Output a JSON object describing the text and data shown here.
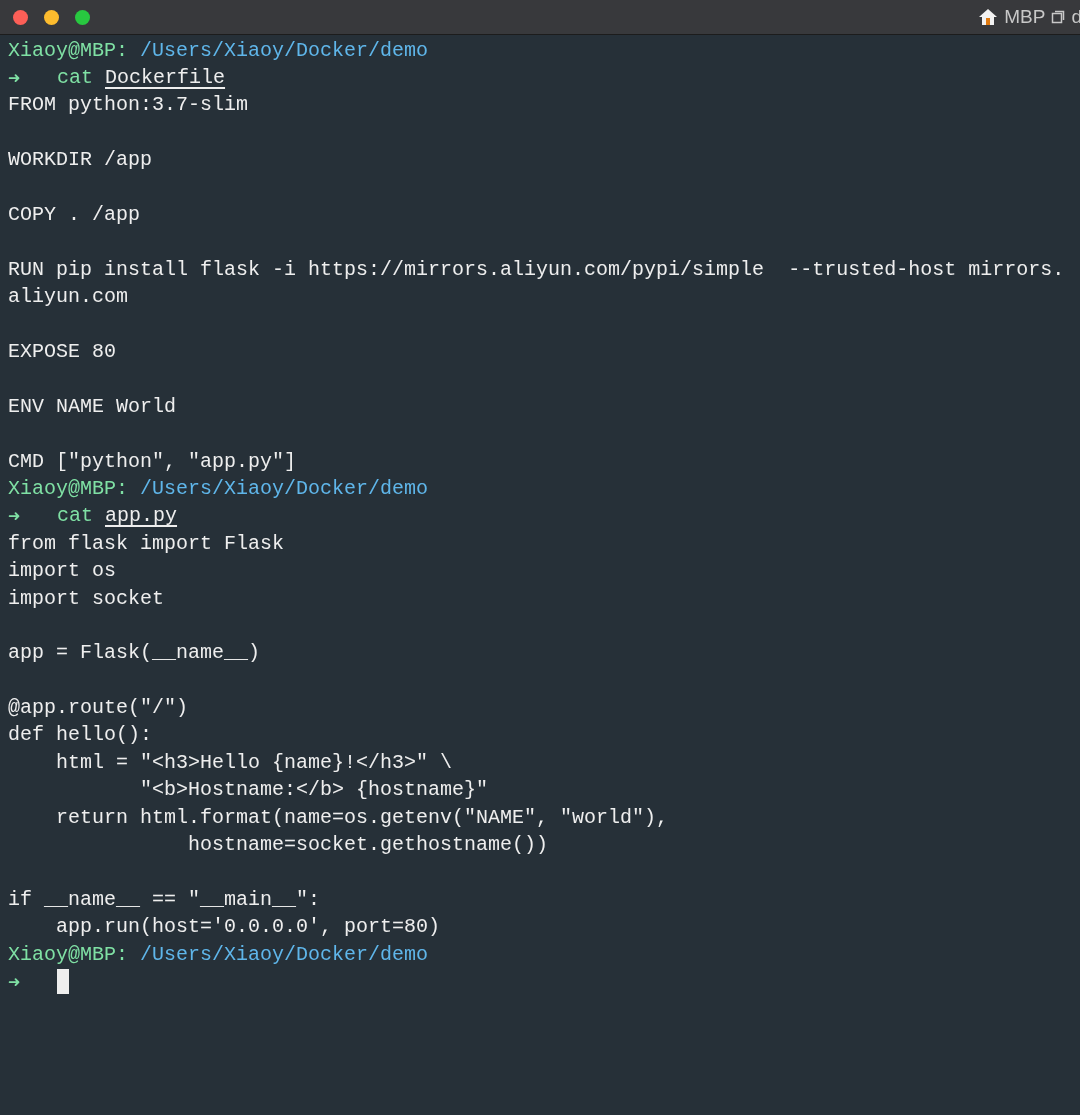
{
  "window": {
    "title": "MBP",
    "title_cut": "d"
  },
  "lines": [
    {
      "kind": "prompt",
      "user": "Xiaoy@MBP:",
      "path": "/Users/Xiaoy/Docker/demo"
    },
    {
      "kind": "command",
      "arrow": "➜",
      "cmd": "cat",
      "arg": "Dockerfile"
    },
    {
      "kind": "output",
      "text": "FROM python:3.7-slim"
    },
    {
      "kind": "blank"
    },
    {
      "kind": "output",
      "text": "WORKDIR /app"
    },
    {
      "kind": "blank"
    },
    {
      "kind": "output",
      "text": "COPY . /app"
    },
    {
      "kind": "blank"
    },
    {
      "kind": "output",
      "text": "RUN pip install flask -i https://mirrors.aliyun.com/pypi/simple  --trusted-host mirrors."
    },
    {
      "kind": "output",
      "text": "aliyun.com"
    },
    {
      "kind": "blank"
    },
    {
      "kind": "output",
      "text": "EXPOSE 80"
    },
    {
      "kind": "blank"
    },
    {
      "kind": "output",
      "text": "ENV NAME World"
    },
    {
      "kind": "blank"
    },
    {
      "kind": "output",
      "text": "CMD [\"python\", \"app.py\"]"
    },
    {
      "kind": "prompt",
      "user": "Xiaoy@MBP:",
      "path": "/Users/Xiaoy/Docker/demo"
    },
    {
      "kind": "command",
      "arrow": "➜",
      "cmd": "cat",
      "arg": "app.py"
    },
    {
      "kind": "output",
      "text": "from flask import Flask"
    },
    {
      "kind": "output",
      "text": "import os"
    },
    {
      "kind": "output",
      "text": "import socket"
    },
    {
      "kind": "blank"
    },
    {
      "kind": "output",
      "text": "app = Flask(__name__)"
    },
    {
      "kind": "blank"
    },
    {
      "kind": "output",
      "text": "@app.route(\"/\")"
    },
    {
      "kind": "output",
      "text": "def hello():"
    },
    {
      "kind": "output",
      "text": "    html = \"<h3>Hello {name}!</h3>\" \\"
    },
    {
      "kind": "output",
      "text": "           \"<b>Hostname:</b> {hostname}\""
    },
    {
      "kind": "output",
      "text": "    return html.format(name=os.getenv(\"NAME\", \"world\"),"
    },
    {
      "kind": "output",
      "text": "               hostname=socket.gethostname())"
    },
    {
      "kind": "blank"
    },
    {
      "kind": "output",
      "text": "if __name__ == \"__main__\":"
    },
    {
      "kind": "output",
      "text": "    app.run(host='0.0.0.0', port=80)"
    },
    {
      "kind": "prompt",
      "user": "Xiaoy@MBP:",
      "path": "/Users/Xiaoy/Docker/demo"
    },
    {
      "kind": "cursor",
      "arrow": "➜"
    }
  ]
}
